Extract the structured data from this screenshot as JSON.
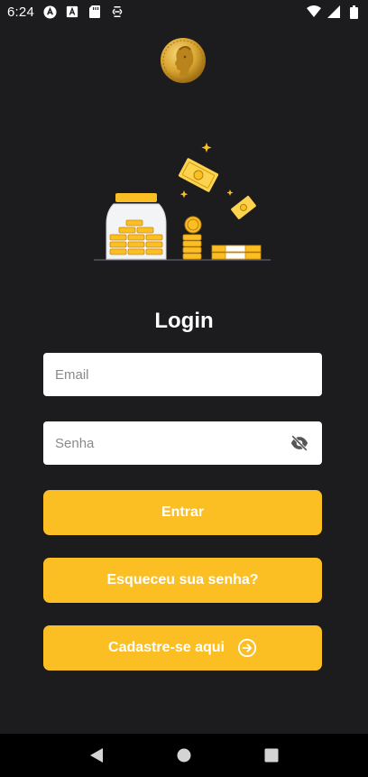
{
  "status_bar": {
    "time": "6:24",
    "icons": [
      "autofill-icon",
      "font-icon",
      "sd-card-icon",
      "screencast-icon"
    ],
    "right_icons": [
      "wifi-icon",
      "signal-icon",
      "battery-icon"
    ]
  },
  "logo": {
    "icon": "coin-icon"
  },
  "hero": {
    "icon": "money-jar-illustration"
  },
  "login": {
    "title": "Login",
    "email_placeholder": "Email",
    "email_value": "",
    "password_placeholder": "Senha",
    "password_value": "",
    "eye_icon": "eye-off-icon"
  },
  "buttons": {
    "login_label": "Entrar",
    "forgot_label": "Esqueceu sua senha?",
    "signup_label": "Cadastre-se aqui",
    "signup_icon": "arrow-right-circle-icon"
  },
  "colors": {
    "background": "#1c1c1e",
    "accent": "#fbbf24",
    "input_bg": "#ffffff",
    "nav_bg": "#000000"
  },
  "nav": {
    "icons": [
      "back-icon",
      "home-icon",
      "recents-icon"
    ]
  }
}
